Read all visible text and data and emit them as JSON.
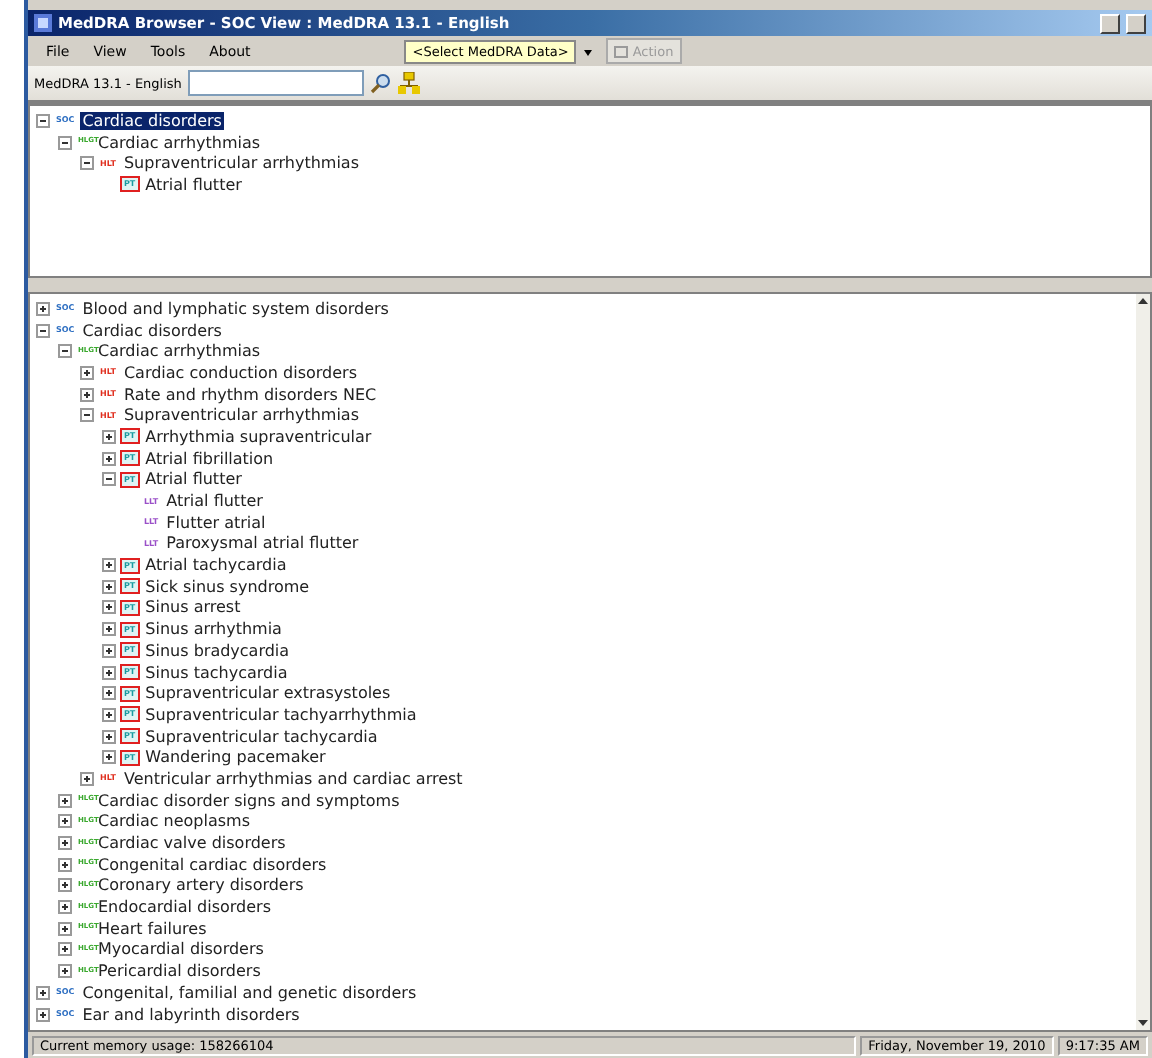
{
  "window": {
    "title": "MedDRA Browser - SOC View : MedDRA 13.1 - English"
  },
  "menu": [
    "File",
    "View",
    "Tools",
    "About"
  ],
  "data_select": {
    "value": "<Select MedDRA Data>"
  },
  "action_button": {
    "label": "Action",
    "disabled": true
  },
  "toolbar": {
    "label": "MedDRA 13.1 - English"
  },
  "upper_tree": [
    {
      "kind": "soc",
      "badge": "SOC",
      "label": "Cardiac disorders",
      "selected": true,
      "expanded": true,
      "children": [
        {
          "kind": "hlgt",
          "badge": "HLGT",
          "label": "Cardiac arrhythmias",
          "selected": false,
          "expanded": true,
          "children": [
            {
              "kind": "hlt",
              "badge": "HLT",
              "label": "Supraventricular arrhythmias",
              "selected": false,
              "expanded": true,
              "children": [
                {
                  "kind": "pt",
                  "badge": "PT",
                  "label": "Atrial flutter",
                  "selected": false
                }
              ]
            }
          ]
        }
      ]
    }
  ],
  "lower_tree": [
    {
      "kind": "soc",
      "badge": "SOC",
      "label": "Blood and lymphatic system disorders",
      "selected": false,
      "expanded": false
    },
    {
      "kind": "soc",
      "badge": "SOC",
      "label": "Cardiac disorders",
      "selected": false,
      "expanded": true,
      "children": [
        {
          "kind": "hlgt",
          "badge": "HLGT",
          "label": "Cardiac arrhythmias",
          "selected": false,
          "expanded": true,
          "children": [
            {
              "kind": "hlt",
              "badge": "HLT",
              "label": "Cardiac conduction disorders",
              "selected": false,
              "expanded": false
            },
            {
              "kind": "hlt",
              "badge": "HLT",
              "label": "Rate and rhythm disorders NEC",
              "selected": false,
              "expanded": false
            },
            {
              "kind": "hlt",
              "badge": "HLT",
              "label": "Supraventricular arrhythmias",
              "selected": false,
              "expanded": true,
              "children": [
                {
                  "kind": "pt",
                  "badge": "PT",
                  "label": "Arrhythmia supraventricular",
                  "selected": false,
                  "expanded": false
                },
                {
                  "kind": "pt",
                  "badge": "PT",
                  "label": "Atrial fibrillation",
                  "selected": false,
                  "expanded": false
                },
                {
                  "kind": "pt",
                  "badge": "PT",
                  "label": "Atrial flutter",
                  "selected": false,
                  "expanded": true,
                  "children": [
                    {
                      "kind": "llt",
                      "badge": "LLT",
                      "label": "Atrial flutter",
                      "selected": false
                    },
                    {
                      "kind": "llt",
                      "badge": "LLT",
                      "label": "Flutter atrial",
                      "selected": false
                    },
                    {
                      "kind": "llt",
                      "badge": "LLT",
                      "label": "Paroxysmal atrial flutter",
                      "selected": false
                    }
                  ]
                },
                {
                  "kind": "pt",
                  "badge": "PT",
                  "label": "Atrial tachycardia",
                  "selected": false,
                  "expanded": false
                },
                {
                  "kind": "pt",
                  "badge": "PT",
                  "label": "Sick sinus syndrome",
                  "selected": false,
                  "expanded": false
                },
                {
                  "kind": "pt",
                  "badge": "PT",
                  "label": "Sinus arrest",
                  "selected": false,
                  "expanded": false
                },
                {
                  "kind": "pt",
                  "badge": "PT",
                  "label": "Sinus arrhythmia",
                  "selected": false,
                  "expanded": false
                },
                {
                  "kind": "pt",
                  "badge": "PT",
                  "label": "Sinus bradycardia",
                  "selected": false,
                  "expanded": false
                },
                {
                  "kind": "pt",
                  "badge": "PT",
                  "label": "Sinus tachycardia",
                  "selected": false,
                  "expanded": false
                },
                {
                  "kind": "pt",
                  "badge": "PT",
                  "label": "Supraventricular extrasystoles",
                  "selected": false,
                  "expanded": false
                },
                {
                  "kind": "pt",
                  "badge": "PT",
                  "label": "Supraventricular tachyarrhythmia",
                  "selected": false,
                  "expanded": false
                },
                {
                  "kind": "pt",
                  "badge": "PT",
                  "label": "Supraventricular tachycardia",
                  "selected": false,
                  "expanded": false
                },
                {
                  "kind": "pt",
                  "badge": "PT",
                  "label": "Wandering pacemaker",
                  "selected": false,
                  "expanded": false
                }
              ]
            },
            {
              "kind": "hlt",
              "badge": "HLT",
              "label": "Ventricular arrhythmias and cardiac arrest",
              "selected": false,
              "expanded": false
            }
          ]
        },
        {
          "kind": "hlgt",
          "badge": "HLGT",
          "label": "Cardiac disorder signs and symptoms",
          "selected": false,
          "expanded": false
        },
        {
          "kind": "hlgt",
          "badge": "HLGT",
          "label": "Cardiac neoplasms",
          "selected": false,
          "expanded": false
        },
        {
          "kind": "hlgt",
          "badge": "HLGT",
          "label": "Cardiac valve disorders",
          "selected": false,
          "expanded": false
        },
        {
          "kind": "hlgt",
          "badge": "HLGT",
          "label": "Congenital cardiac disorders",
          "selected": false,
          "expanded": false
        },
        {
          "kind": "hlgt",
          "badge": "HLGT",
          "label": "Coronary artery disorders",
          "selected": false,
          "expanded": false
        },
        {
          "kind": "hlgt",
          "badge": "HLGT",
          "label": "Endocardial disorders",
          "selected": false,
          "expanded": false
        },
        {
          "kind": "hlgt",
          "badge": "HLGT",
          "label": "Heart failures",
          "selected": false,
          "expanded": false
        },
        {
          "kind": "hlgt",
          "badge": "HLGT",
          "label": "Myocardial disorders",
          "selected": false,
          "expanded": false
        },
        {
          "kind": "hlgt",
          "badge": "HLGT",
          "label": "Pericardial disorders",
          "selected": false,
          "expanded": false
        }
      ]
    },
    {
      "kind": "soc",
      "badge": "SOC",
      "label": "Congenital, familial and genetic disorders",
      "selected": false,
      "expanded": false
    },
    {
      "kind": "soc",
      "badge": "SOC",
      "label": "Ear and labyrinth disorders",
      "selected": false,
      "expanded": false
    }
  ],
  "status_bar": {
    "memory": "Current memory usage: 158266104",
    "date": "Friday, November 19, 2010",
    "time": "9:17:35 AM"
  }
}
